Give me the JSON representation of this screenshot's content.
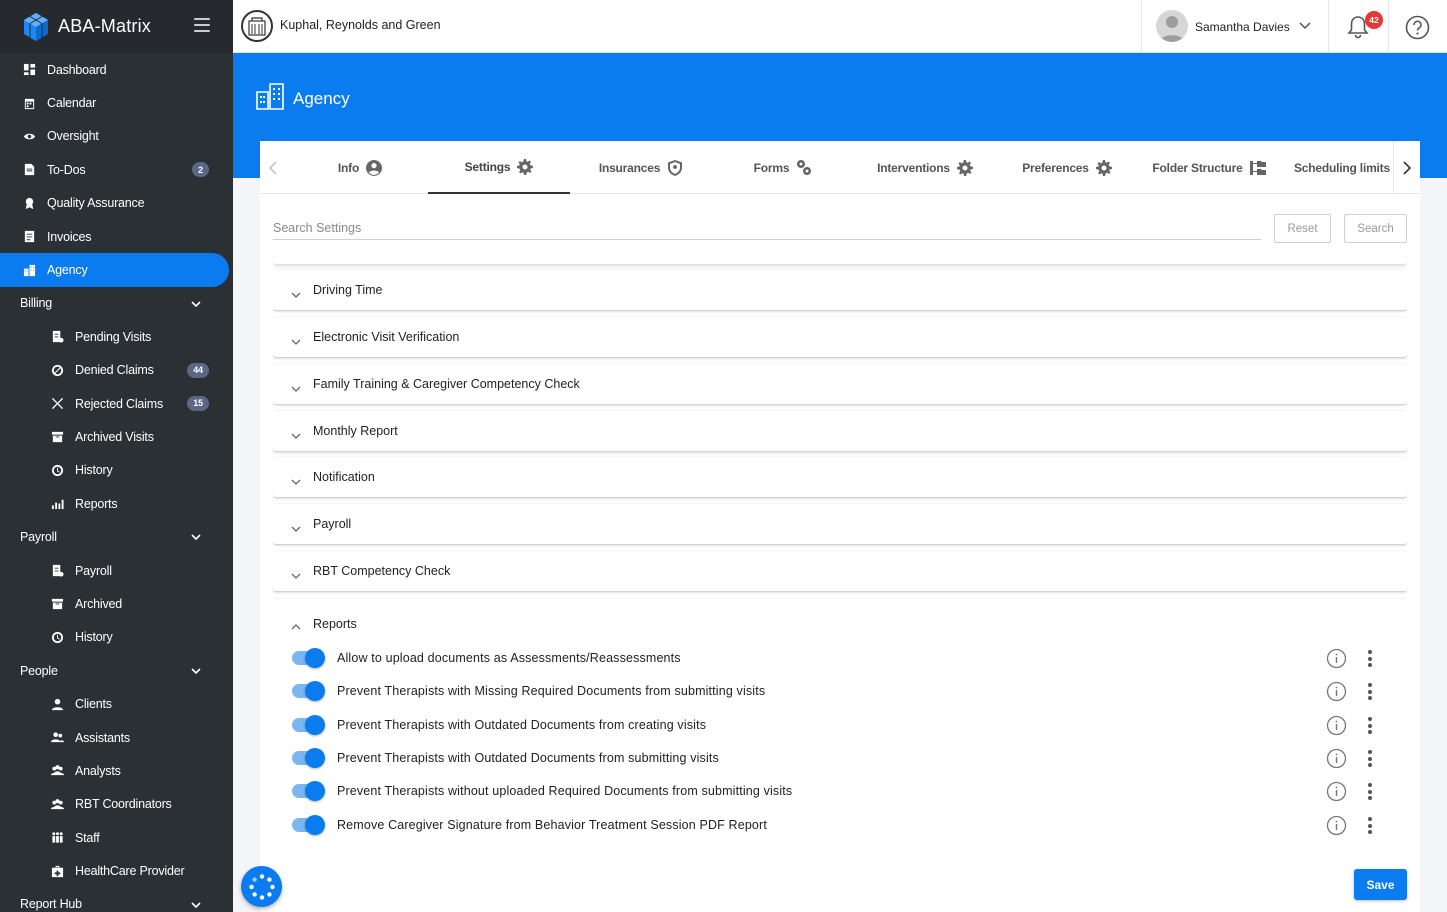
{
  "app": {
    "name": "ABA-Matrix"
  },
  "sidebar": {
    "items": [
      {
        "label": "Dashboard",
        "icon": "dashboard-icon"
      },
      {
        "label": "Calendar",
        "icon": "calendar-icon"
      },
      {
        "label": "Oversight",
        "icon": "eye-icon"
      },
      {
        "label": "To-Dos",
        "icon": "todo-icon",
        "badge": "2"
      },
      {
        "label": "Quality Assurance",
        "icon": "quality-icon"
      },
      {
        "label": "Invoices",
        "icon": "invoice-icon"
      },
      {
        "label": "Agency",
        "icon": "agency-icon",
        "active": true
      }
    ],
    "billing": {
      "label": "Billing",
      "items": [
        {
          "label": "Pending Visits"
        },
        {
          "label": "Denied Claims",
          "badge": "44"
        },
        {
          "label": "Rejected Claims",
          "badge": "15"
        },
        {
          "label": "Archived Visits"
        },
        {
          "label": "History"
        },
        {
          "label": "Reports"
        }
      ]
    },
    "payroll": {
      "label": "Payroll",
      "items": [
        {
          "label": "Payroll"
        },
        {
          "label": "Archived"
        },
        {
          "label": "History"
        }
      ]
    },
    "people": {
      "label": "People",
      "items": [
        {
          "label": "Clients"
        },
        {
          "label": "Assistants"
        },
        {
          "label": "Analysts"
        },
        {
          "label": "RBT Coordinators"
        },
        {
          "label": "Staff"
        },
        {
          "label": "HealthCare Provider"
        }
      ]
    },
    "report_hub": {
      "label": "Report Hub"
    }
  },
  "topbar": {
    "company": "Kuphal, Reynolds and Green",
    "user": "Samantha Davies",
    "notifications": "42"
  },
  "page": {
    "title": "Agency"
  },
  "tabs": [
    {
      "label": "Info",
      "icon": "user-circle-icon"
    },
    {
      "label": "Settings",
      "icon": "gear-icon",
      "active": true
    },
    {
      "label": "Insurances",
      "icon": "shield-icon"
    },
    {
      "label": "Forms",
      "icon": "gears-icon"
    },
    {
      "label": "Interventions",
      "icon": "gear-icon"
    },
    {
      "label": "Preferences",
      "icon": "gear-icon"
    },
    {
      "label": "Folder Structure",
      "icon": "folder-tree-icon"
    },
    {
      "label": "Scheduling limits",
      "icon": ""
    }
  ],
  "search": {
    "placeholder": "Search Settings",
    "value": "",
    "reset_label": "Reset",
    "search_label": "Search"
  },
  "sections": [
    {
      "label": "Driving Time"
    },
    {
      "label": "Electronic Visit Verification"
    },
    {
      "label": "Family Training & Caregiver Competency Check"
    },
    {
      "label": "Monthly Report"
    },
    {
      "label": "Notification"
    },
    {
      "label": "Payroll"
    },
    {
      "label": "RBT Competency Check"
    }
  ],
  "open_section": {
    "label": "Reports",
    "settings": [
      {
        "label": "Allow to upload documents as Assessments/Reassessments",
        "enabled": true
      },
      {
        "label": "Prevent Therapists with Missing Required Documents from submitting visits",
        "enabled": true
      },
      {
        "label": "Prevent Therapists with Outdated Documents from creating visits",
        "enabled": true
      },
      {
        "label": "Prevent Therapists with Outdated Documents from submitting visits",
        "enabled": true
      },
      {
        "label": "Prevent Therapists without uploaded Required Documents from submitting visits",
        "enabled": true
      },
      {
        "label": "Remove Caregiver Signature from Behavior Treatment Session PDF Report",
        "enabled": true
      }
    ]
  },
  "save_label": "Save",
  "colors": {
    "primary": "#0a7cf0",
    "sidebar": "#2b3035",
    "badge": "#5b6785",
    "alert": "#e53935"
  }
}
